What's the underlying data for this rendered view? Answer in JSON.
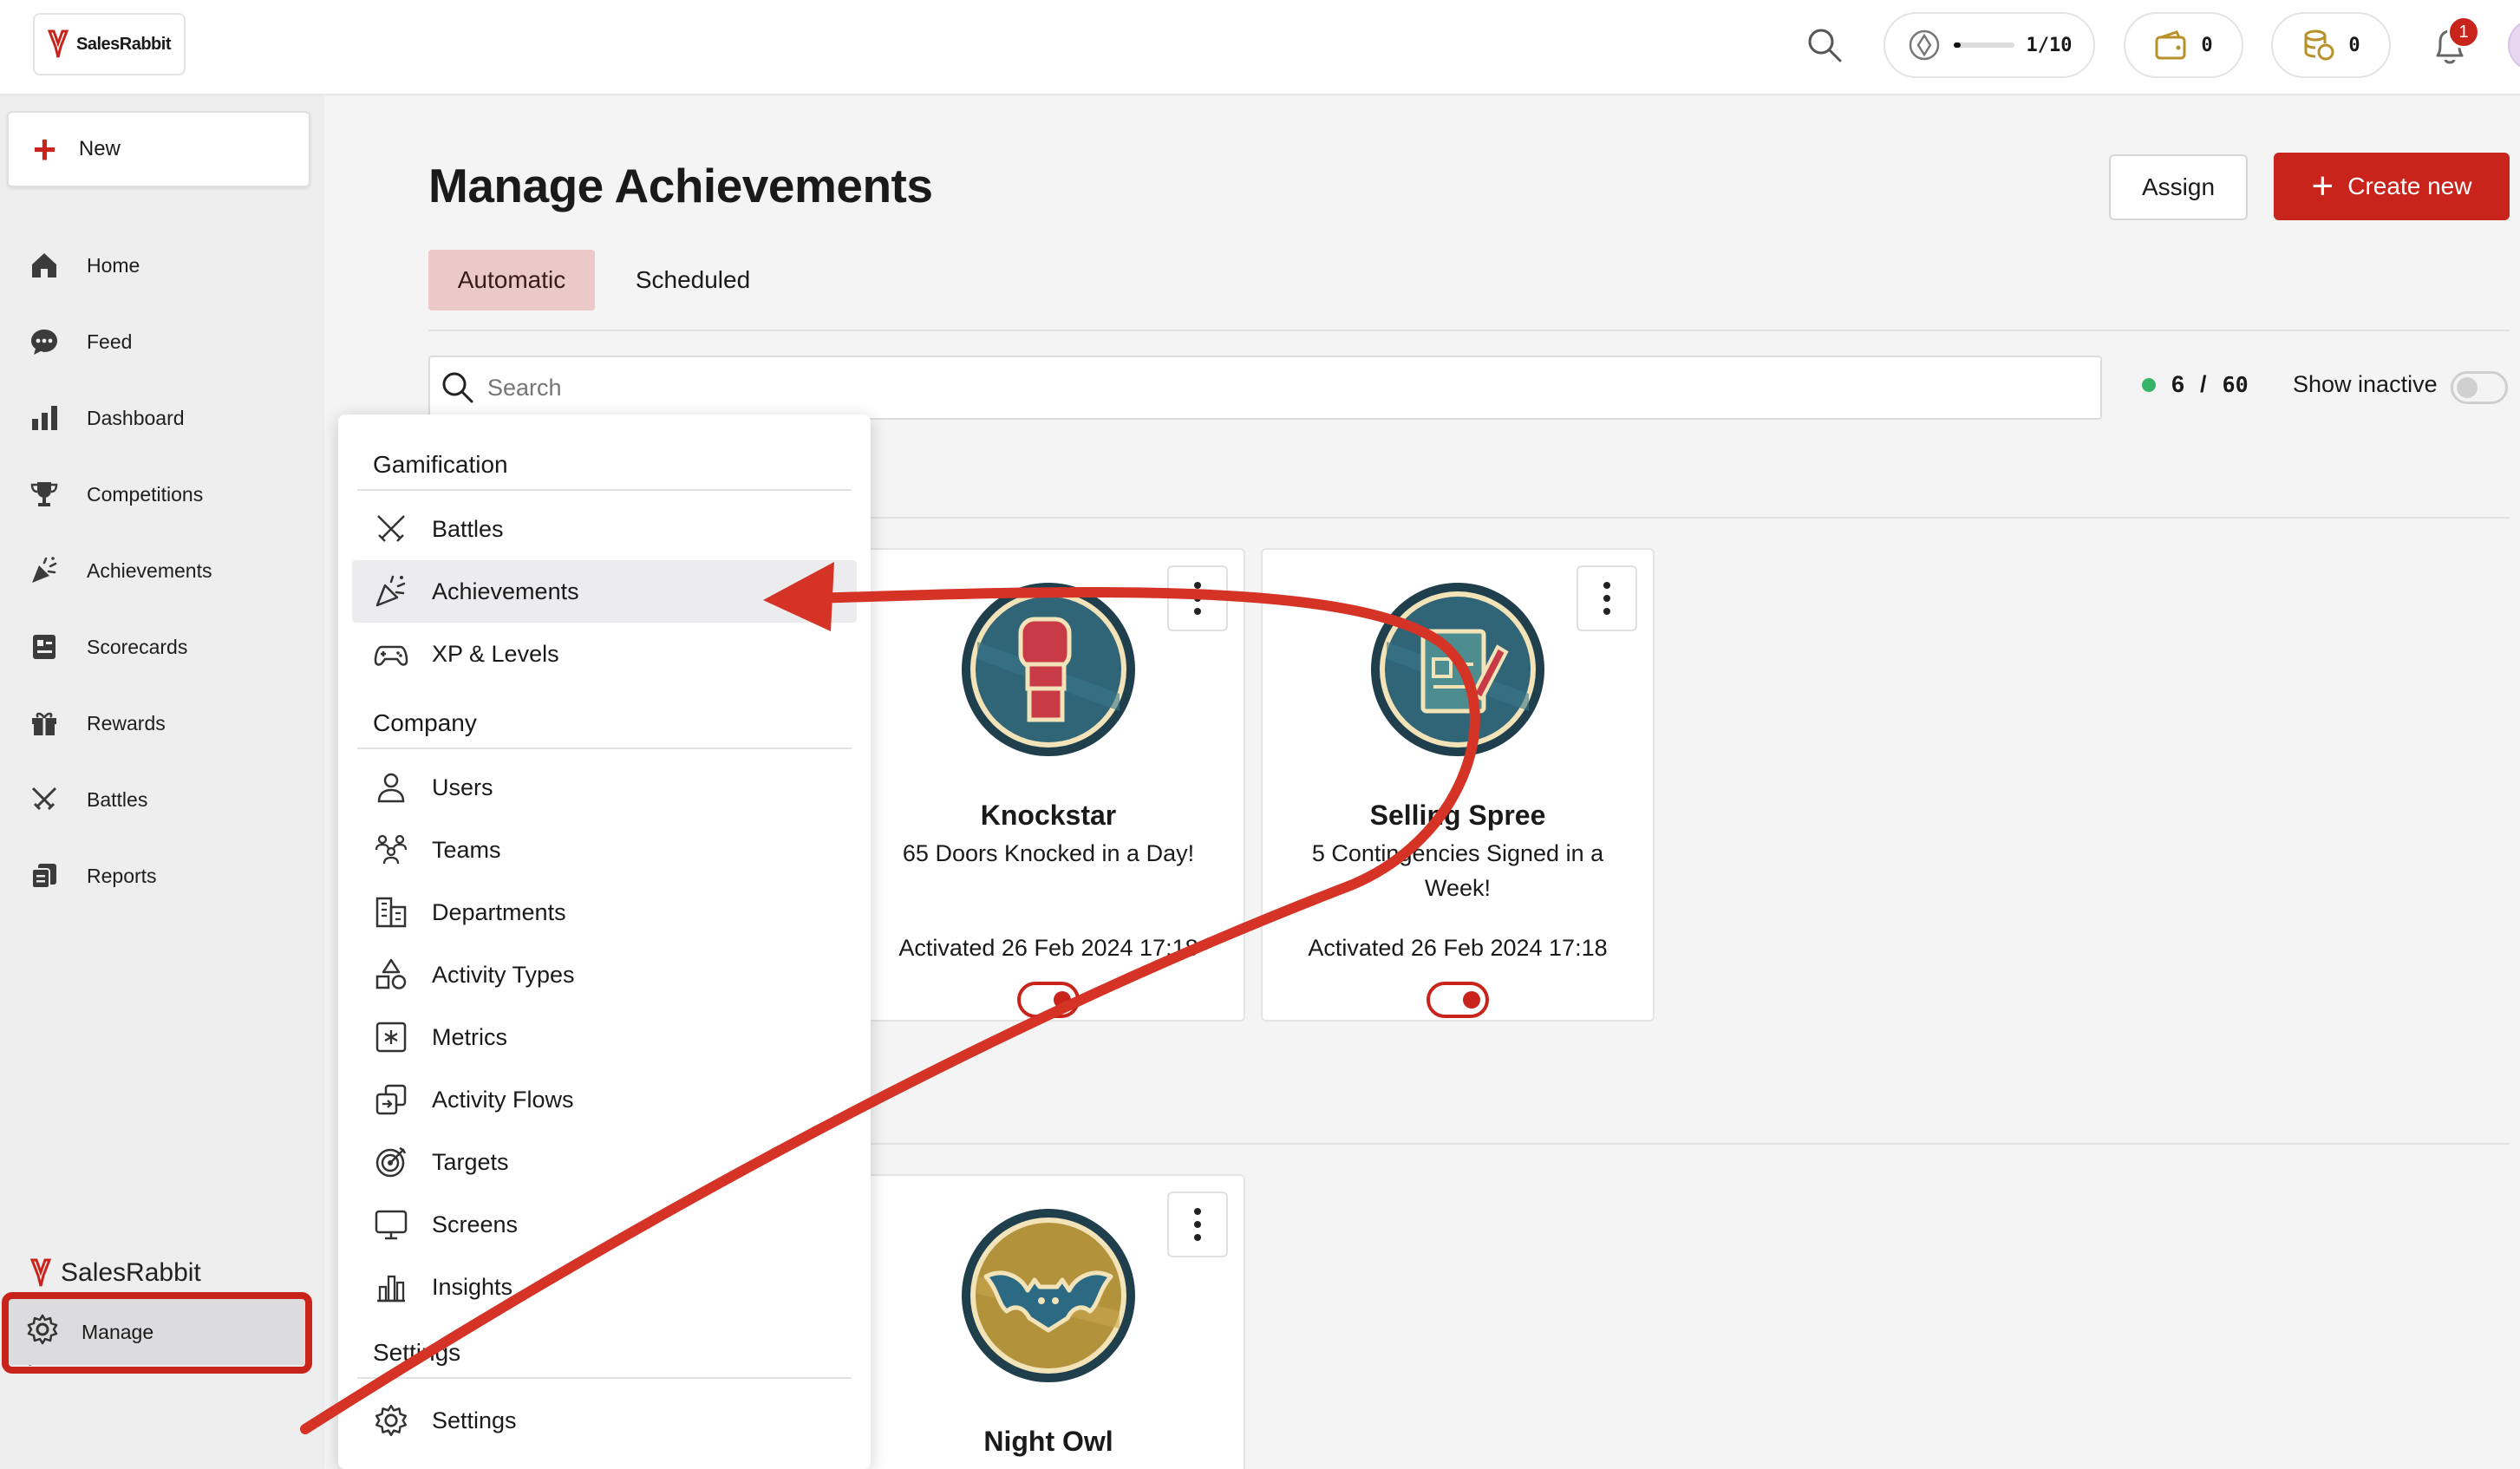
{
  "brand": {
    "name": "SalesRabbit",
    "accent": "#c8241c"
  },
  "topbar": {
    "xp_label": "1/10",
    "xp_progress": 0.1,
    "wallet_count": "0",
    "coins_count": "0",
    "notification_count": "1"
  },
  "sidebar": {
    "new_label": "New",
    "items": [
      {
        "label": "Home",
        "icon": "home-icon"
      },
      {
        "label": "Feed",
        "icon": "chat-icon"
      },
      {
        "label": "Dashboard",
        "icon": "bar-chart-icon"
      },
      {
        "label": "Competitions",
        "icon": "trophy-icon"
      },
      {
        "label": "Achievements",
        "icon": "confetti-icon"
      },
      {
        "label": "Scorecards",
        "icon": "scorecard-icon"
      },
      {
        "label": "Rewards",
        "icon": "gift-icon"
      },
      {
        "label": "Battles",
        "icon": "swords-icon"
      },
      {
        "label": "Reports",
        "icon": "reports-icon"
      }
    ],
    "brand_label": "SalesRabbit",
    "collapse_glyph": "|←",
    "manage_label": "Manage"
  },
  "main": {
    "title": "Manage Achievements",
    "assign_label": "Assign",
    "create_label": "Create new",
    "tabs": [
      {
        "label": "Automatic",
        "active": true
      },
      {
        "label": "Scheduled",
        "active": false
      }
    ],
    "search_placeholder": "Search",
    "count_active": "6",
    "count_sep": "/",
    "count_total": "60",
    "show_inactive_label": "Show inactive"
  },
  "cards": [
    {
      "title": "Knockstar",
      "desc": "65 Doors Knocked in a Day!",
      "activated": "Activated 26 Feb 2024 17:18",
      "badge": "boxing-glove-icon"
    },
    {
      "title": "Selling Spree",
      "desc": "5 Contingencies Signed in a Week!",
      "activated": "Activated 26 Feb 2024 17:18",
      "badge": "contract-icon"
    },
    {
      "title": "Night Owl",
      "badge": "bat-icon"
    }
  ],
  "menu": {
    "gamification_head": "Gamification",
    "gamification": [
      {
        "label": "Battles",
        "icon": "swords-icon"
      },
      {
        "label": "Achievements",
        "icon": "confetti-icon",
        "active": true
      },
      {
        "label": "XP & Levels",
        "icon": "gamepad-icon"
      }
    ],
    "company_head": "Company",
    "company": [
      {
        "label": "Users",
        "icon": "user-icon"
      },
      {
        "label": "Teams",
        "icon": "team-icon"
      },
      {
        "label": "Departments",
        "icon": "building-icon"
      },
      {
        "label": "Activity Types",
        "icon": "shapes-icon"
      },
      {
        "label": "Metrics",
        "icon": "metrics-icon"
      },
      {
        "label": "Activity Flows",
        "icon": "flows-icon"
      },
      {
        "label": "Targets",
        "icon": "target-icon"
      },
      {
        "label": "Screens",
        "icon": "monitor-icon"
      },
      {
        "label": "Insights",
        "icon": "insights-icon"
      }
    ],
    "settings_head": "Settings",
    "settings": [
      {
        "label": "Settings",
        "icon": "gear-icon"
      }
    ]
  }
}
